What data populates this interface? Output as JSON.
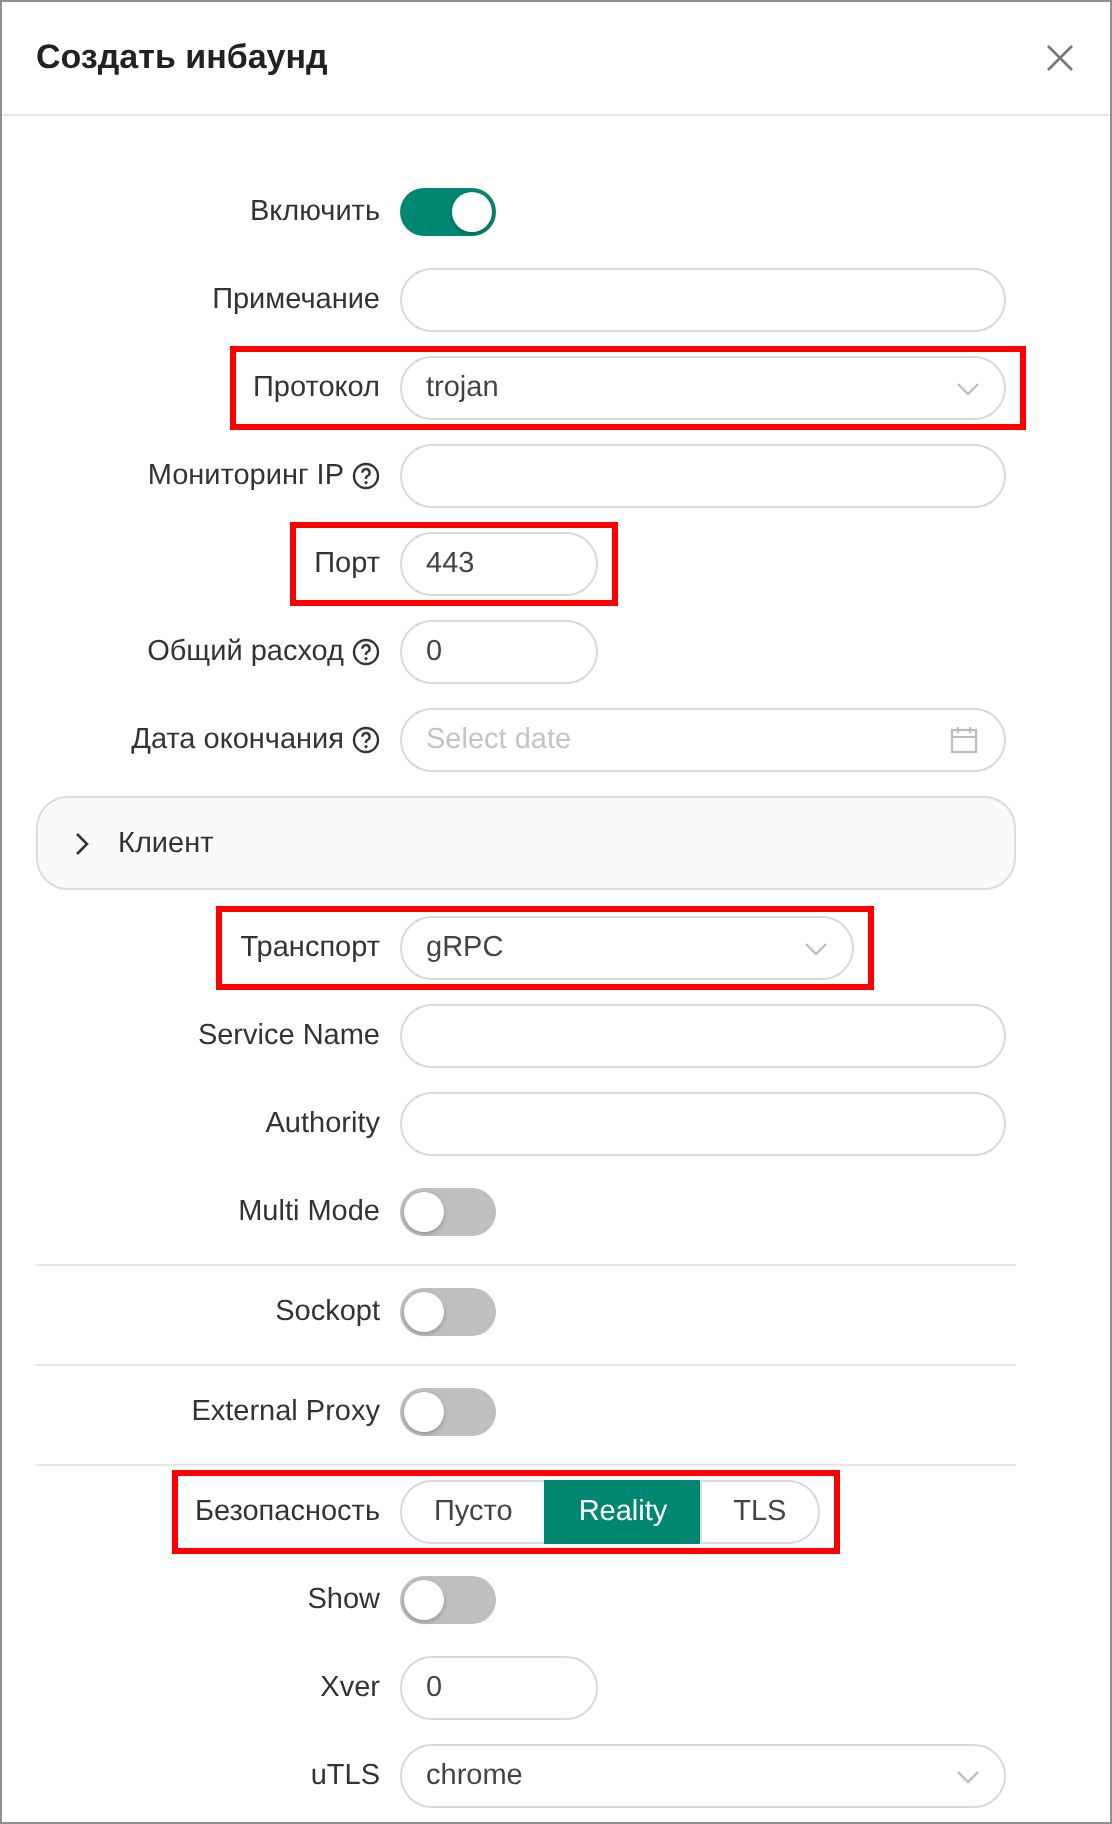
{
  "dialog": {
    "title": "Создать инбаунд"
  },
  "fields": [
    {
      "kind": "switch",
      "label": "Включить",
      "on": true,
      "highlighted": false
    },
    {
      "kind": "input",
      "label": "Примечание",
      "highlighted": false
    },
    {
      "kind": "select",
      "label": "Протокол",
      "value": "trojan",
      "highlighted": true
    },
    {
      "kind": "input",
      "label": "Мониторинг IP",
      "help": true,
      "highlighted": false
    },
    {
      "kind": "number",
      "label": "Порт",
      "value": "443",
      "help": false,
      "highlighted": true
    },
    {
      "kind": "number",
      "label": "Общий расход",
      "help": true,
      "value": "0",
      "highlighted": false
    },
    {
      "kind": "date",
      "label": "Дата окончания",
      "help": true,
      "placeholder": "Select date",
      "highlighted": false
    },
    {
      "kind": "panel",
      "label": "Клиент",
      "expanded": false
    },
    {
      "kind": "dropdown",
      "label": "Транспорт",
      "value": "gRPC",
      "highlighted": true
    },
    {
      "kind": "input",
      "label": "Service Name",
      "highlighted": false
    },
    {
      "kind": "input",
      "label": "Authority",
      "highlighted": false
    },
    {
      "kind": "switch",
      "label": "Multi Mode",
      "on": false,
      "divider": true,
      "highlighted": false
    },
    {
      "kind": "switch",
      "label": "Sockopt",
      "on": false,
      "divider": true,
      "highlighted": false
    },
    {
      "kind": "switch",
      "label": "External Proxy",
      "on": false,
      "divider": true,
      "highlighted": false
    },
    {
      "kind": "radio",
      "label": "Безопасность",
      "highlighted": true,
      "options": [
        {
          "label": "Пусто",
          "selected": false
        },
        {
          "label": "Reality",
          "selected": true
        },
        {
          "label": "TLS",
          "selected": false
        }
      ]
    },
    {
      "kind": "switch",
      "label": "Show",
      "on": false,
      "highlighted": false
    },
    {
      "kind": "number",
      "label": "Xver",
      "value": "0",
      "highlighted": false
    },
    {
      "kind": "select",
      "label": "uTLS",
      "value": "chrome",
      "highlighted": false
    }
  ]
}
